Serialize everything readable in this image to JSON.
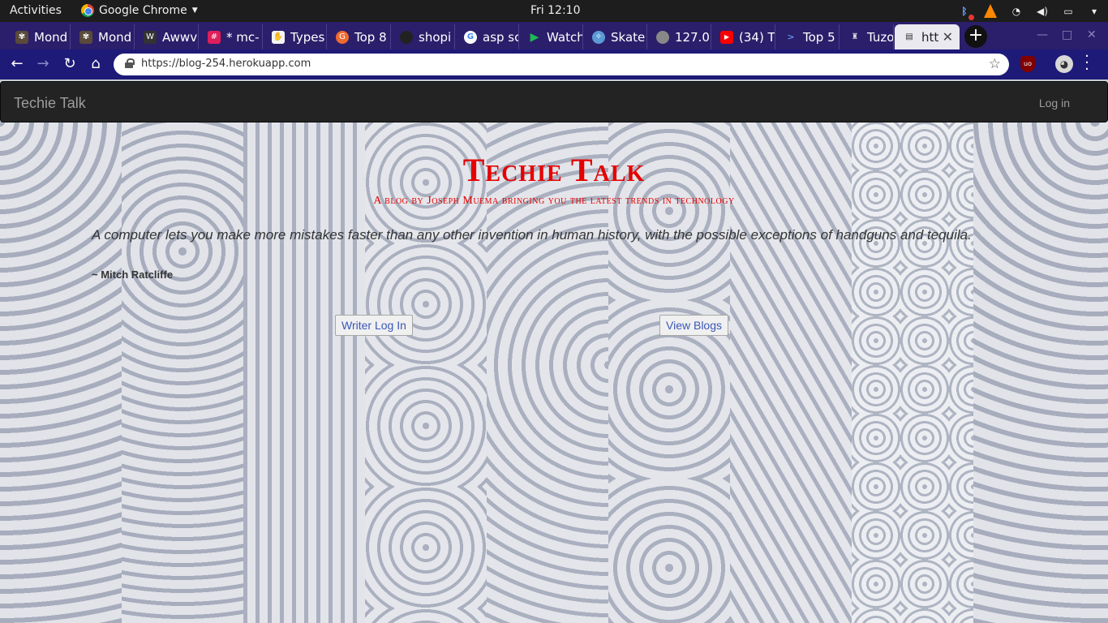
{
  "topbar": {
    "activities": "Activities",
    "app_name": "Google Chrome",
    "clock": "Fri 12:10"
  },
  "tabs": [
    {
      "label": "Mond",
      "favicon_color": "#5a4a3a"
    },
    {
      "label": "Mond",
      "favicon_color": "#5a4a3a"
    },
    {
      "label": "Awwv",
      "favicon_color": "#333333"
    },
    {
      "label": "* mc-",
      "favicon_color": "#e01e5a"
    },
    {
      "label": "Types",
      "favicon_color": "#f5f5f5"
    },
    {
      "label": "Top 8",
      "favicon_color": "#f16a2d"
    },
    {
      "label": "shopi",
      "favicon_color": "#222222"
    },
    {
      "label": "asp sc",
      "favicon_color": "#ffffff"
    },
    {
      "label": "Watch",
      "favicon_color": "#1db954"
    },
    {
      "label": "Skate",
      "favicon_color": "#5b9bd5"
    },
    {
      "label": "127.0",
      "favicon_color": "#888888"
    },
    {
      "label": "(34) T",
      "favicon_color": "#ff0000"
    },
    {
      "label": "Top 5",
      "favicon_color": "#2b1f6b"
    },
    {
      "label": "Tuzo",
      "favicon_color": "#111111"
    },
    {
      "label": "htt",
      "favicon_color": "#333333",
      "active": true
    }
  ],
  "toolbar": {
    "url": "https://blog-254.herokuapp.com"
  },
  "site": {
    "brand": "Techie Talk",
    "login": "Log in",
    "title": "Techie Talk",
    "subtitle": "A blog by Joseph Muema bringing you the latest trends in technology",
    "quote": "A computer lets you make more mistakes faster than any other invention in human history, with the possible exceptions of handguns and tequila.",
    "quote_author": "~ Mitch Ratcliffe",
    "writer_button": "Writer Log In",
    "blogs_button": "View Blogs"
  },
  "colors": {
    "title_red": "#e60000",
    "navbar": "#232323",
    "tabstrip": "#2b1f6b",
    "toolbar": "#1e1a78"
  }
}
